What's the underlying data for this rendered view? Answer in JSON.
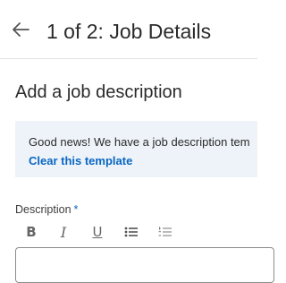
{
  "header": {
    "back_icon": "arrow-left-icon",
    "title": "1 of 2: Job Details"
  },
  "section": {
    "title": "Add a job description"
  },
  "banner": {
    "text": "Good news! We have a job description tem",
    "link": "Clear this template"
  },
  "description": {
    "label": "Description",
    "required_marker": "*"
  },
  "toolbar": {
    "bold": "B",
    "italic": "I",
    "underline": "U",
    "bullets_icon": "bulleted-list-icon",
    "numbers_icon": "numbered-list-icon"
  },
  "colors": {
    "accent": "#0a66c2",
    "banner_bg": "#edf3f8",
    "text": "#2b2b2b"
  }
}
